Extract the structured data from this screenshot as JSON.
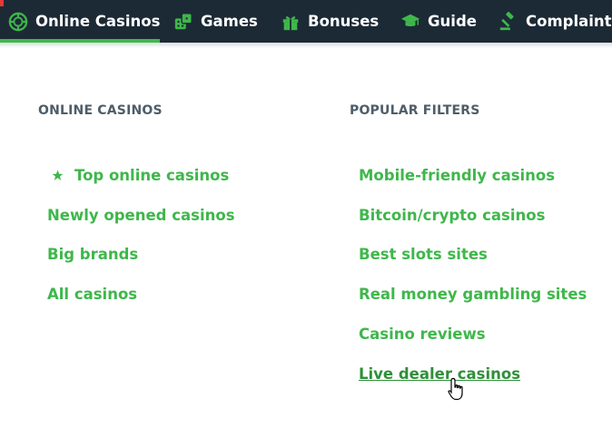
{
  "nav": {
    "items": [
      {
        "label": "Online Casinos",
        "icon": "casino-chip-icon"
      },
      {
        "label": "Games",
        "icon": "dice-icon"
      },
      {
        "label": "Bonuses",
        "icon": "gift-icon"
      },
      {
        "label": "Guide",
        "icon": "graduation-cap-icon"
      },
      {
        "label": "Complaints",
        "icon": "gavel-icon"
      }
    ],
    "active_index": 0
  },
  "dropdown": {
    "left_column": {
      "title": "ONLINE CASINOS",
      "links": [
        "Top online casinos",
        "Newly opened casinos",
        "Big brands",
        "All casinos"
      ]
    },
    "right_column": {
      "title": "POPULAR FILTERS",
      "links": [
        "Mobile-friendly casinos",
        "Bitcoin/crypto casinos",
        "Best slots sites",
        "Real money gambling sites",
        "Casino reviews",
        "Live dealer casinos"
      ]
    },
    "hovered_link": "Live dealer casinos"
  },
  "colors": {
    "navbar_bg": "#1c2a35",
    "accent_green": "#3fb74b",
    "hover_green": "#2f8f39",
    "section_title": "#4e5d69"
  }
}
